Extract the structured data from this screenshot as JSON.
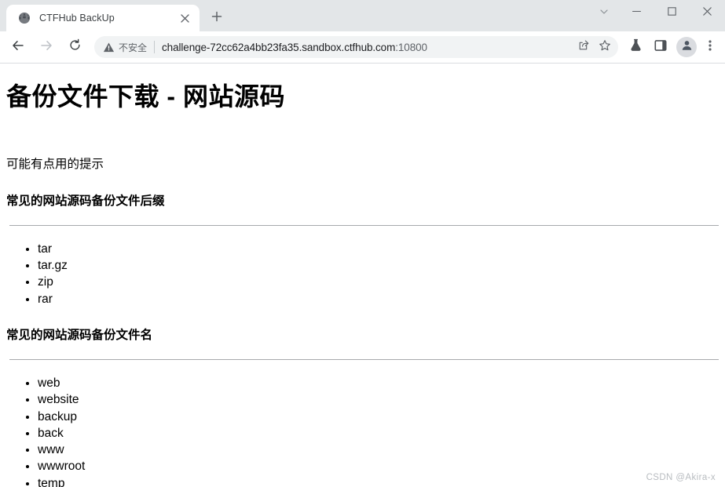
{
  "browser": {
    "tab": {
      "title": "CTFHub BackUp",
      "favicon_icon": "globe-icon",
      "close_icon": "close-icon"
    },
    "new_tab_icon": "plus-icon",
    "window_controls": {
      "tab_search_icon": "chevron-down-icon",
      "minimize_icon": "minimize-icon",
      "maximize_icon": "maximize-icon",
      "close_icon": "close-icon"
    },
    "toolbar": {
      "back_icon": "back-arrow-icon",
      "forward_icon": "forward-arrow-icon",
      "reload_icon": "reload-icon",
      "security_warning_icon": "warning-triangle-icon",
      "security_label": "不安全",
      "url": "challenge-72cc62a4bb23fa35.sandbox.ctfhub.com",
      "url_port": ":10800",
      "share_icon": "share-icon",
      "bookmark_icon": "star-icon",
      "labs_icon": "flask-icon",
      "side_panel_icon": "side-panel-icon",
      "profile_icon": "person-avatar-icon",
      "menu_icon": "three-dot-menu-icon"
    }
  },
  "page": {
    "title": "备份文件下载 - 网站源码",
    "hint": "可能有点用的提示",
    "sections": [
      {
        "heading": "常见的网站源码备份文件后缀",
        "items": [
          "tar",
          "tar.gz",
          "zip",
          "rar"
        ]
      },
      {
        "heading": "常见的网站源码备份文件名",
        "items": [
          "web",
          "website",
          "backup",
          "back",
          "www",
          "wwwroot",
          "temp"
        ]
      }
    ],
    "watermark": "CSDN @Akira-x"
  }
}
